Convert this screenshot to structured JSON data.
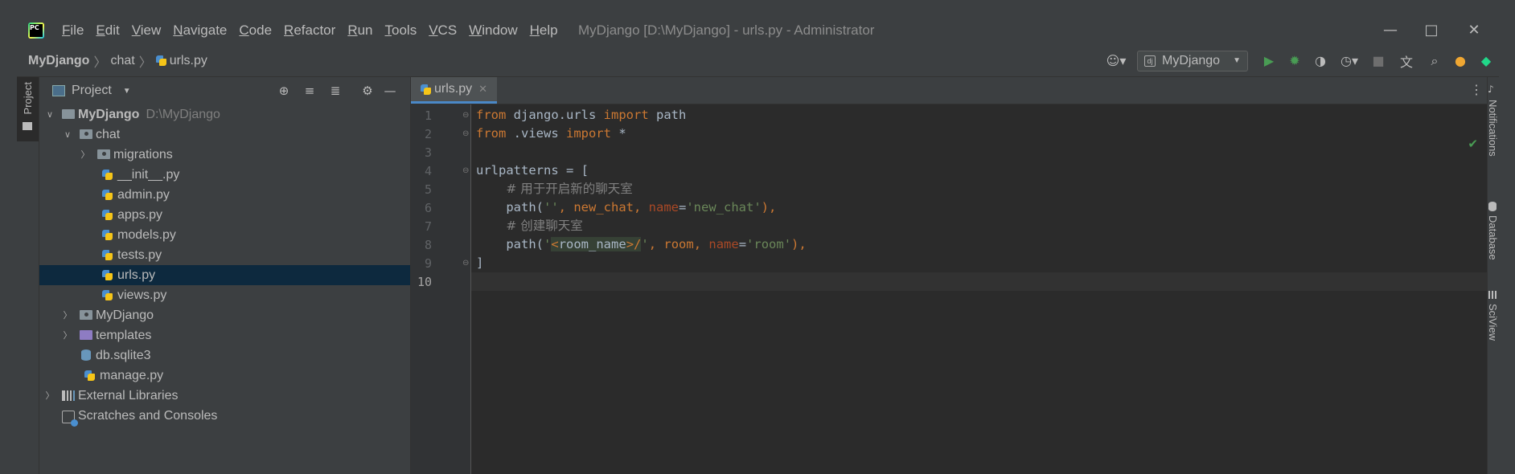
{
  "titlebar": {
    "menu": [
      "File",
      "Edit",
      "View",
      "Navigate",
      "Code",
      "Refactor",
      "Run",
      "Tools",
      "VCS",
      "Window",
      "Help"
    ],
    "window_title": "MyDjango [D:\\MyDjango] - urls.py - Administrator"
  },
  "navbar": {
    "crumbs": [
      "MyDjango",
      "chat",
      "urls.py"
    ],
    "run_config": "MyDjango"
  },
  "left_strip": {
    "project_tab": "Project"
  },
  "right_strip": [
    "Notifications",
    "Database",
    "SciView"
  ],
  "project": {
    "title": "Project",
    "tree": [
      {
        "label": "MyDjango",
        "path": "D:\\MyDjango",
        "bold": true
      },
      {
        "label": "chat"
      },
      {
        "label": "migrations"
      },
      {
        "label": "__init__.py"
      },
      {
        "label": "admin.py"
      },
      {
        "label": "apps.py"
      },
      {
        "label": "models.py"
      },
      {
        "label": "tests.py"
      },
      {
        "label": "urls.py",
        "selected": true
      },
      {
        "label": "views.py"
      },
      {
        "label": "MyDjango"
      },
      {
        "label": "templates"
      },
      {
        "label": "db.sqlite3"
      },
      {
        "label": "manage.py"
      },
      {
        "label": "External Libraries"
      },
      {
        "label": "Scratches and Consoles"
      }
    ]
  },
  "editor": {
    "tab": "urls.py",
    "line_numbers": [
      "1",
      "2",
      "3",
      "4",
      "5",
      "6",
      "7",
      "8",
      "9",
      "10"
    ],
    "lines": {
      "l1": {
        "kw1": "from",
        "t1": " django.urls ",
        "kw2": "import",
        "t2": " path"
      },
      "l2": {
        "kw1": "from",
        "t1": " .views ",
        "kw2": "import",
        "t2": " *"
      },
      "l4": {
        "t1": "urlpatterns = ["
      },
      "l5": {
        "indent": "    ",
        "comment": "# 用于开启新的聊天室"
      },
      "l6": {
        "t1": "    path(",
        "s1": "''",
        "t2": ", new_chat, ",
        "p1": "name",
        "t3": "=",
        "s2": "'new_chat'",
        "t4": "),"
      },
      "l7": {
        "indent": "    ",
        "comment": "# 创建聊天室"
      },
      "l8": {
        "t1": "    path(",
        "s1": "'",
        "inj1": "<",
        "inj2": "room_name",
        "inj3": ">/",
        "s2": "'",
        "t2": ", room, ",
        "p1": "name",
        "t3": "=",
        "s3": "'room'",
        "t4": "),"
      },
      "l9": {
        "t1": "]"
      }
    }
  },
  "colors": {
    "keyword": "#cc7832",
    "string": "#6a8759",
    "comment": "#808080",
    "param": "#aa4926",
    "selection": "#0d293e",
    "accent": "#4a88c7"
  }
}
